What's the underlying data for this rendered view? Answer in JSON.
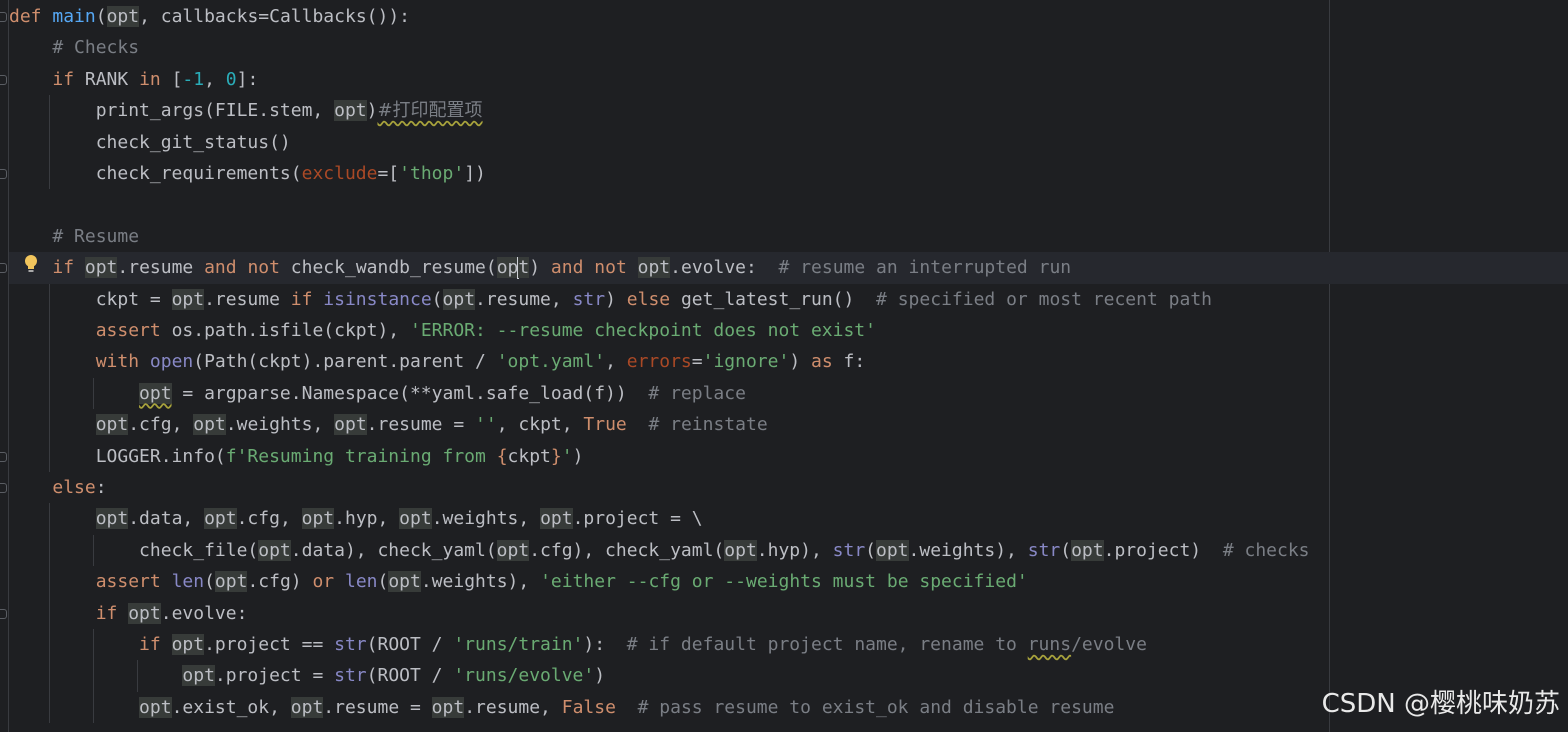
{
  "editor": {
    "lines": [
      {
        "tokens": [
          [
            "kw",
            "def "
          ],
          [
            "def",
            "main"
          ],
          [
            "t",
            "("
          ],
          [
            "opt",
            "opt"
          ],
          [
            "t",
            ", callbacks=Callbacks()):"
          ]
        ]
      },
      {
        "tokens": [
          [
            "t",
            "    "
          ],
          [
            "cmt",
            "# Checks"
          ]
        ]
      },
      {
        "tokens": [
          [
            "t",
            "    "
          ],
          [
            "kw",
            "if "
          ],
          [
            "t",
            "RANK "
          ],
          [
            "kw",
            "in "
          ],
          [
            "t",
            "["
          ],
          [
            "num",
            "-1"
          ],
          [
            "t",
            ", "
          ],
          [
            "num",
            "0"
          ],
          [
            "t",
            "]:"
          ]
        ]
      },
      {
        "tokens": [
          [
            "t",
            "        print_args(FILE.stem, "
          ],
          [
            "opt",
            "opt"
          ],
          [
            "t",
            ")"
          ],
          [
            "cn",
            "#打印配置项"
          ]
        ]
      },
      {
        "tokens": [
          [
            "t",
            "        check_git_status()"
          ]
        ]
      },
      {
        "tokens": [
          [
            "t",
            "        check_requirements("
          ],
          [
            "param",
            "exclude"
          ],
          [
            "t",
            "=["
          ],
          [
            "str",
            "'thop'"
          ],
          [
            "t",
            "])"
          ]
        ]
      },
      {
        "tokens": []
      },
      {
        "tokens": [
          [
            "t",
            "    "
          ],
          [
            "cmt",
            "# Resume"
          ]
        ]
      },
      {
        "tokens": [
          [
            "t",
            "    "
          ],
          [
            "kw",
            "if "
          ],
          [
            "opt",
            "opt"
          ],
          [
            "t",
            ".resume "
          ],
          [
            "kw",
            "and not "
          ],
          [
            "t",
            "check_wandb_resume("
          ],
          [
            "opt",
            "op"
          ],
          [
            "caret",
            ""
          ],
          [
            "opt",
            "t"
          ],
          [
            "t",
            ") "
          ],
          [
            "kw",
            "and not "
          ],
          [
            "opt",
            "opt"
          ],
          [
            "t",
            ".evolve:  "
          ],
          [
            "cmt",
            "# resume an interrupted run"
          ]
        ]
      },
      {
        "tokens": [
          [
            "t",
            "        ckpt = "
          ],
          [
            "opt",
            "opt"
          ],
          [
            "t",
            ".resume "
          ],
          [
            "kw",
            "if "
          ],
          [
            "builtin",
            "isinstance"
          ],
          [
            "t",
            "("
          ],
          [
            "opt",
            "opt"
          ],
          [
            "t",
            ".resume, "
          ],
          [
            "builtin",
            "str"
          ],
          [
            "t",
            ") "
          ],
          [
            "kw",
            "else "
          ],
          [
            "t",
            "get_latest_run()  "
          ],
          [
            "cmt",
            "# specified or most recent path"
          ]
        ]
      },
      {
        "tokens": [
          [
            "t",
            "        "
          ],
          [
            "kw",
            "assert "
          ],
          [
            "t",
            "os.path.isfile(ckpt), "
          ],
          [
            "str",
            "'ERROR: --resume checkpoint does not exist'"
          ]
        ]
      },
      {
        "tokens": [
          [
            "t",
            "        "
          ],
          [
            "kw",
            "with "
          ],
          [
            "builtin",
            "open"
          ],
          [
            "t",
            "(Path(ckpt).parent.parent / "
          ],
          [
            "str",
            "'opt.yaml'"
          ],
          [
            "t",
            ", "
          ],
          [
            "param",
            "errors"
          ],
          [
            "t",
            "="
          ],
          [
            "str",
            "'ignore'"
          ],
          [
            "t",
            ") "
          ],
          [
            "kw",
            "as "
          ],
          [
            "t",
            "f:"
          ]
        ]
      },
      {
        "tokens": [
          [
            "t",
            "            "
          ],
          [
            "optw",
            "opt"
          ],
          [
            "t",
            " = argparse.Namespace(**yaml.safe_load(f))  "
          ],
          [
            "cmt",
            "# replace"
          ]
        ]
      },
      {
        "tokens": [
          [
            "t",
            "        "
          ],
          [
            "opt",
            "opt"
          ],
          [
            "t",
            ".cfg, "
          ],
          [
            "opt",
            "opt"
          ],
          [
            "t",
            ".weights, "
          ],
          [
            "opt",
            "opt"
          ],
          [
            "t",
            ".resume = "
          ],
          [
            "str",
            "''"
          ],
          [
            "t",
            ", ckpt, "
          ],
          [
            "kw",
            "True  "
          ],
          [
            "cmt",
            "# reinstate"
          ]
        ]
      },
      {
        "tokens": [
          [
            "t",
            "        LOGGER.info("
          ],
          [
            "str",
            "f'Resuming training from "
          ],
          [
            "kw",
            "{"
          ],
          [
            "t",
            "ckpt"
          ],
          [
            "kw",
            "}"
          ],
          [
            "str",
            "'"
          ],
          [
            "t",
            ")"
          ]
        ]
      },
      {
        "tokens": [
          [
            "t",
            "    "
          ],
          [
            "kw",
            "else"
          ],
          [
            "t",
            ":"
          ]
        ]
      },
      {
        "tokens": [
          [
            "t",
            "        "
          ],
          [
            "opt",
            "opt"
          ],
          [
            "t",
            ".data, "
          ],
          [
            "opt",
            "opt"
          ],
          [
            "t",
            ".cfg, "
          ],
          [
            "opt",
            "opt"
          ],
          [
            "t",
            ".hyp, "
          ],
          [
            "opt",
            "opt"
          ],
          [
            "t",
            ".weights, "
          ],
          [
            "opt",
            "opt"
          ],
          [
            "t",
            ".project = \\"
          ]
        ]
      },
      {
        "tokens": [
          [
            "t",
            "            check_file("
          ],
          [
            "opt",
            "opt"
          ],
          [
            "t",
            ".data), check_yaml("
          ],
          [
            "opt",
            "opt"
          ],
          [
            "t",
            ".cfg), check_yaml("
          ],
          [
            "opt",
            "opt"
          ],
          [
            "t",
            ".hyp), "
          ],
          [
            "builtin",
            "str"
          ],
          [
            "t",
            "("
          ],
          [
            "opt",
            "opt"
          ],
          [
            "t",
            ".weights), "
          ],
          [
            "builtin",
            "str"
          ],
          [
            "t",
            "("
          ],
          [
            "opt",
            "opt"
          ],
          [
            "t",
            ".project)  "
          ],
          [
            "cmt",
            "# checks"
          ]
        ]
      },
      {
        "tokens": [
          [
            "t",
            "        "
          ],
          [
            "kw",
            "assert "
          ],
          [
            "builtin",
            "len"
          ],
          [
            "t",
            "("
          ],
          [
            "opt",
            "opt"
          ],
          [
            "t",
            ".cfg) "
          ],
          [
            "kw",
            "or "
          ],
          [
            "builtin",
            "len"
          ],
          [
            "t",
            "("
          ],
          [
            "opt",
            "opt"
          ],
          [
            "t",
            ".weights), "
          ],
          [
            "str",
            "'either --cfg or --weights must be specified'"
          ]
        ]
      },
      {
        "tokens": [
          [
            "t",
            "        "
          ],
          [
            "kw",
            "if "
          ],
          [
            "opt",
            "opt"
          ],
          [
            "t",
            ".evolve:"
          ]
        ]
      },
      {
        "tokens": [
          [
            "t",
            "            "
          ],
          [
            "kw",
            "if "
          ],
          [
            "opt",
            "opt"
          ],
          [
            "t",
            ".project == "
          ],
          [
            "builtin",
            "str"
          ],
          [
            "t",
            "(ROOT / "
          ],
          [
            "str",
            "'runs/train'"
          ],
          [
            "t",
            "):  "
          ],
          [
            "cmt",
            "# if default project name, rename to "
          ],
          [
            "cmtw",
            "runs"
          ],
          [
            "cmt",
            "/evolve"
          ]
        ]
      },
      {
        "tokens": [
          [
            "t",
            "                "
          ],
          [
            "opt",
            "opt"
          ],
          [
            "t",
            ".project = "
          ],
          [
            "builtin",
            "str"
          ],
          [
            "t",
            "(ROOT / "
          ],
          [
            "str",
            "'runs/evolve'"
          ],
          [
            "t",
            ")"
          ]
        ]
      },
      {
        "tokens": [
          [
            "t",
            "            "
          ],
          [
            "opt",
            "opt"
          ],
          [
            "t",
            ".exist_ok, "
          ],
          [
            "opt",
            "opt"
          ],
          [
            "t",
            ".resume = "
          ],
          [
            "opt",
            "opt"
          ],
          [
            "t",
            ".resume, "
          ],
          [
            "kw",
            "False  "
          ],
          [
            "cmt",
            "# pass resume to exist_ok and disable resume"
          ]
        ]
      }
    ]
  },
  "watermark": {
    "text": "CSDN @樱桃味奶苏"
  },
  "colors": {
    "background": "#1e1f22",
    "keyword": "#cf8e6d",
    "function": "#56a8f5",
    "string": "#6aab73",
    "comment": "#7a7e85",
    "number": "#2aacb8"
  }
}
